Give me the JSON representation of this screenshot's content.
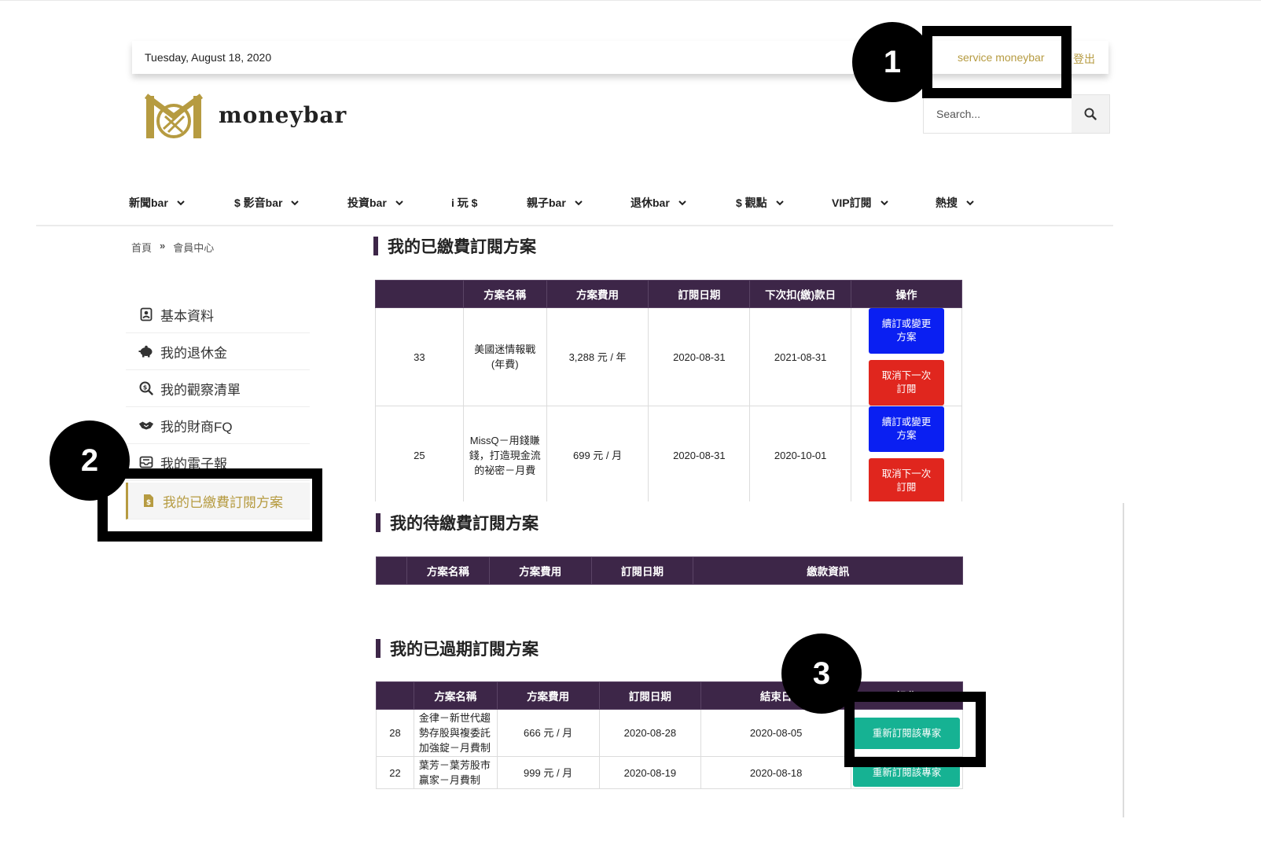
{
  "header": {
    "date": "Tuesday, August 18, 2020",
    "user": "service moneybar",
    "logout": "登出"
  },
  "brand": {
    "name": "moneybar",
    "accent": "#b69b41"
  },
  "search": {
    "placeholder": "Search...",
    "icon": "search-icon"
  },
  "nav": [
    {
      "label": "新聞bar"
    },
    {
      "label": "$ 影音bar"
    },
    {
      "label": "投資bar"
    },
    {
      "label": "i 玩 $"
    },
    {
      "label": "親子bar"
    },
    {
      "label": "退休bar"
    },
    {
      "label": "$ 觀點"
    },
    {
      "label": "VIP訂閱"
    },
    {
      "label": "熱搜"
    }
  ],
  "breadcrumb": {
    "home": "首頁",
    "sep": "»",
    "current": "會員中心"
  },
  "sidebar": {
    "items": [
      {
        "label": "基本資料",
        "icon": "contact-card-icon"
      },
      {
        "label": "我的退休金",
        "icon": "piggy-bank-icon"
      },
      {
        "label": "我的觀察清單",
        "icon": "magnifier-dollar-icon"
      },
      {
        "label": "我的財商FQ",
        "icon": "handshake-icon"
      },
      {
        "label": "我的電子報",
        "icon": "mail-tray-icon"
      },
      {
        "label": "我的已繳費訂閱方案",
        "icon": "document-dollar-icon"
      }
    ]
  },
  "paid": {
    "title": "我的已繳費訂閱方案",
    "headers": [
      "",
      "方案名稱",
      "方案費用",
      "訂閱日期",
      "下次扣(繳)款日",
      "操作"
    ],
    "rows": [
      {
        "id": "33",
        "name": "美國迷情報戰\n(年費)",
        "fee": "3,288 元 / 年",
        "start": "2020-08-31",
        "next": "2021-08-31",
        "renew": "續訂或變更\n方案",
        "cancel": "取消下一次\n訂閱"
      },
      {
        "id": "25",
        "name": "MissQ－用錢賺\n錢，打造現金流\n的祕密－月費",
        "fee": "699 元 / 月",
        "start": "2020-08-31",
        "next": "2020-10-01",
        "renew": "續訂或變更\n方案",
        "cancel": "取消下一次\n訂閱"
      }
    ]
  },
  "pending": {
    "title": "我的待繳費訂閱方案",
    "headers": [
      "",
      "方案名稱",
      "方案費用",
      "訂閱日期",
      "繳款資訊"
    ]
  },
  "expired": {
    "title": "我的已過期訂閱方案",
    "headers": [
      "",
      "方案名稱",
      "方案費用",
      "訂閱日期",
      "結束日",
      "操作"
    ],
    "rows": [
      {
        "id": "28",
        "name": "金律－新世代趨\n勢存股與複委託\n加強錠－月費制",
        "fee": "666 元 / 月",
        "start": "2020-08-28",
        "end": "2020-08-05",
        "action": "重新訂閱該專家"
      },
      {
        "id": "22",
        "name": "葉芳－葉芳股市\n贏家－月費制",
        "fee": "999 元 / 月",
        "start": "2020-08-19",
        "end": "2020-08-18",
        "action": "重新訂閱該專家"
      }
    ]
  },
  "annotations": {
    "m1": "1",
    "m2": "2",
    "m3": "3"
  },
  "colors": {
    "header_bg": "#3d2648",
    "renew": "#0a1ff2",
    "cancel": "#e0261e",
    "resubscribe": "#16b293"
  }
}
